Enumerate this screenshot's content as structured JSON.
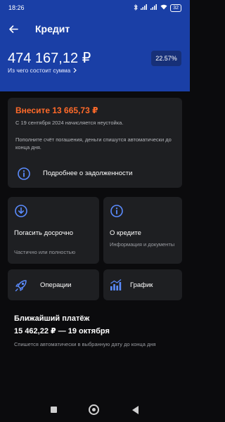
{
  "status_bar": {
    "time": "18:26",
    "icons": [
      "bluetooth-icon",
      "signal-icon",
      "signal-icon",
      "wifi-icon"
    ],
    "battery": "32"
  },
  "header": {
    "title": "Кредит",
    "back_icon": "arrow-left-icon",
    "amount": "474 167,12 ₽",
    "amount_link": "Из чего состоит сумма",
    "rate_badge": "22.57%"
  },
  "payment_card": {
    "title": "Внесите 13 665,73 ₽",
    "warning": "С 19 сентября 2024 начисляется неустойка.",
    "hint": "Пополните счёт погашения, деньги спишутся автоматически до конца дня.",
    "link_label": "Подробнее о задолженности",
    "link_icon": "info-icon"
  },
  "tiles": [
    {
      "title": "Погасить досрочно",
      "subtitle": "Частично или полностью",
      "icon": "download-circle-icon"
    },
    {
      "title": "О кредите",
      "subtitle": "Информация и документы",
      "icon": "info-icon"
    }
  ],
  "actions": [
    {
      "label": "Операции",
      "icon": "rocket-icon"
    },
    {
      "label": "График",
      "icon": "bar-chart-icon"
    }
  ],
  "next_payment": {
    "title": "Ближайший платёж",
    "value": "15 462,22 ₽ — 19 октября",
    "note": "Спишется автоматически в выбранную дату до конца дня"
  },
  "colors": {
    "header_bg": "#1a3fa6",
    "page_bg": "#0b0b0d",
    "card_bg": "#1e1f22",
    "accent_orange": "#ff6a2a",
    "accent_blue": "#5b8cff"
  }
}
